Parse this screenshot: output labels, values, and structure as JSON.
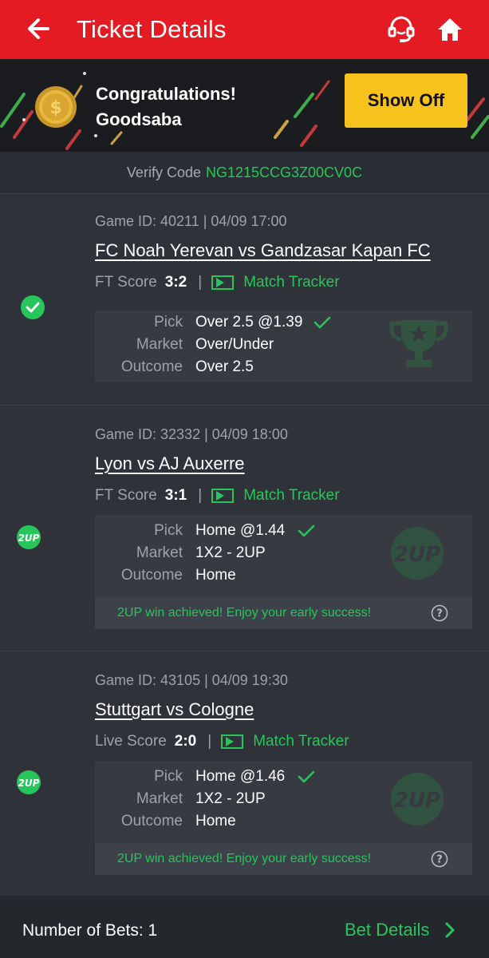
{
  "header": {
    "title": "Ticket Details",
    "back_icon": "arrow-left",
    "support_icon": "headset",
    "home_icon": "home"
  },
  "banner": {
    "line1": "Congratulations!",
    "line2": "Goodsaba",
    "show_off_label": "Show Off"
  },
  "verify": {
    "label": "Verify Code",
    "code": "NG1215CCG3Z00CV0C"
  },
  "bets": [
    {
      "status": "won-check",
      "game_meta": "Game ID: 40211 | 04/09 17:00",
      "teams": "FC Noah Yerevan vs Gandzasar Kapan FC",
      "score_label": "FT Score",
      "score": "3:2",
      "tracker_label": "Match Tracker",
      "pick_label": "Pick",
      "pick_value": "Over 2.5 @1.39",
      "market_label": "Market",
      "market_value": "Over/Under",
      "outcome_label": "Outcome",
      "outcome_value": "Over 2.5",
      "watermark": "trophy"
    },
    {
      "status": "2up",
      "status_text": "2UP",
      "game_meta": "Game ID: 32332 | 04/09 18:00",
      "teams": "Lyon vs AJ Auxerre",
      "score_label": "FT Score",
      "score": "3:1",
      "tracker_label": "Match Tracker",
      "pick_label": "Pick",
      "pick_value": "Home @1.44",
      "market_label": "Market",
      "market_value": "1X2 - 2UP",
      "outcome_label": "Outcome",
      "outcome_value": "Home",
      "watermark": "2UP",
      "note": "2UP win achieved! Enjoy your early success!"
    },
    {
      "status": "2up",
      "status_text": "2UP",
      "game_meta": "Game ID: 43105 | 04/09 19:30",
      "teams": "Stuttgart vs Cologne",
      "score_label": "Live Score",
      "score": "2:0",
      "tracker_label": "Match Tracker",
      "pick_label": "Pick",
      "pick_value": "Home @1.46",
      "market_label": "Market",
      "market_value": "1X2 - 2UP",
      "outcome_label": "Outcome",
      "outcome_value": "Home",
      "watermark": "2UP",
      "note": "2UP win achieved! Enjoy your early success!"
    }
  ],
  "footer": {
    "bets_count": "Number of Bets: 1",
    "bet_details": "Bet Details"
  },
  "colors": {
    "header_red": "#e41b23",
    "accent_green": "#27c65a",
    "show_off_yellow": "#f7c21c",
    "background": "#2a2d33"
  }
}
